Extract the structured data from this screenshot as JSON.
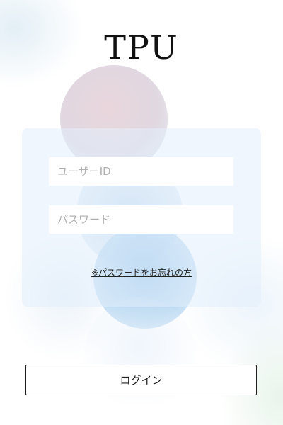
{
  "app": {
    "title": "TPU"
  },
  "login_form": {
    "user_id_placeholder": "ユーザーID",
    "password_placeholder": "パスワード",
    "forgot_password_link": "※パスワードをお忘れの方",
    "login_button": "ログイン"
  },
  "colors": {
    "panel": "#e2eefc",
    "text": "#222222",
    "button_border": "#1f1f1f"
  }
}
